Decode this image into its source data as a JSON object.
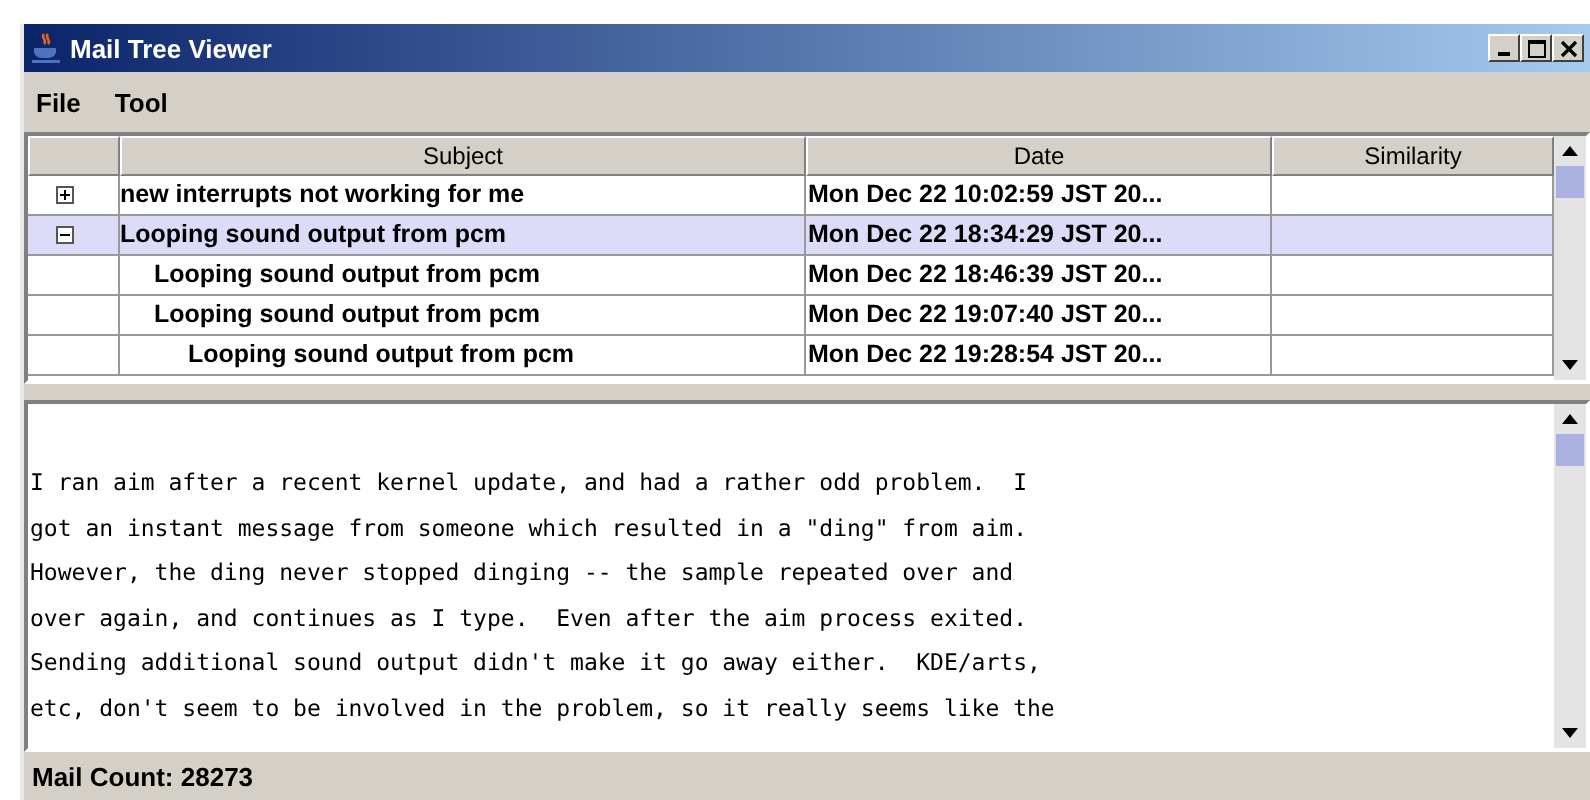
{
  "window": {
    "title": "Mail Tree Viewer"
  },
  "menu": [
    "File",
    "Tool"
  ],
  "table": {
    "columns": [
      "Subject",
      "Date",
      "Similarity"
    ],
    "rows": [
      {
        "subject": "new interrupts not working for me",
        "date": "Mon Dec 22 10:02:59 JST 20...",
        "expanded": false,
        "selected": false
      },
      {
        "subject": "Looping sound output from pcm",
        "date": "Mon Dec 22 18:34:29 JST 20...",
        "expanded": true,
        "selected": true,
        "children": [
          {
            "subject": "Looping sound output from pcm",
            "date": "Mon Dec 22 18:46:39 JST 20...",
            "selected": false
          },
          {
            "subject": "Looping sound output from pcm",
            "date": "Mon Dec 22 19:07:40 JST 20...",
            "selected": false,
            "children": [
              {
                "subject": "Looping sound output from pcm",
                "date": "Mon Dec 22 19:28:54 JST 20...",
                "selected": false
              }
            ]
          }
        ]
      }
    ]
  },
  "message": [
    "I ran aim after a recent kernel update, and had a rather odd problem.  I",
    "got an instant message from someone which resulted in a \"ding\" from aim.",
    "However, the ding never stopped dinging -- the sample repeated over and",
    "over again, and continues as I type.  Even after the aim process exited.",
    "Sending additional sound output didn't make it go away either.  KDE/arts,",
    "etc, don't seem to be involved in the problem, so it really seems like the"
  ],
  "status_bar": "Mail Count: 28273"
}
